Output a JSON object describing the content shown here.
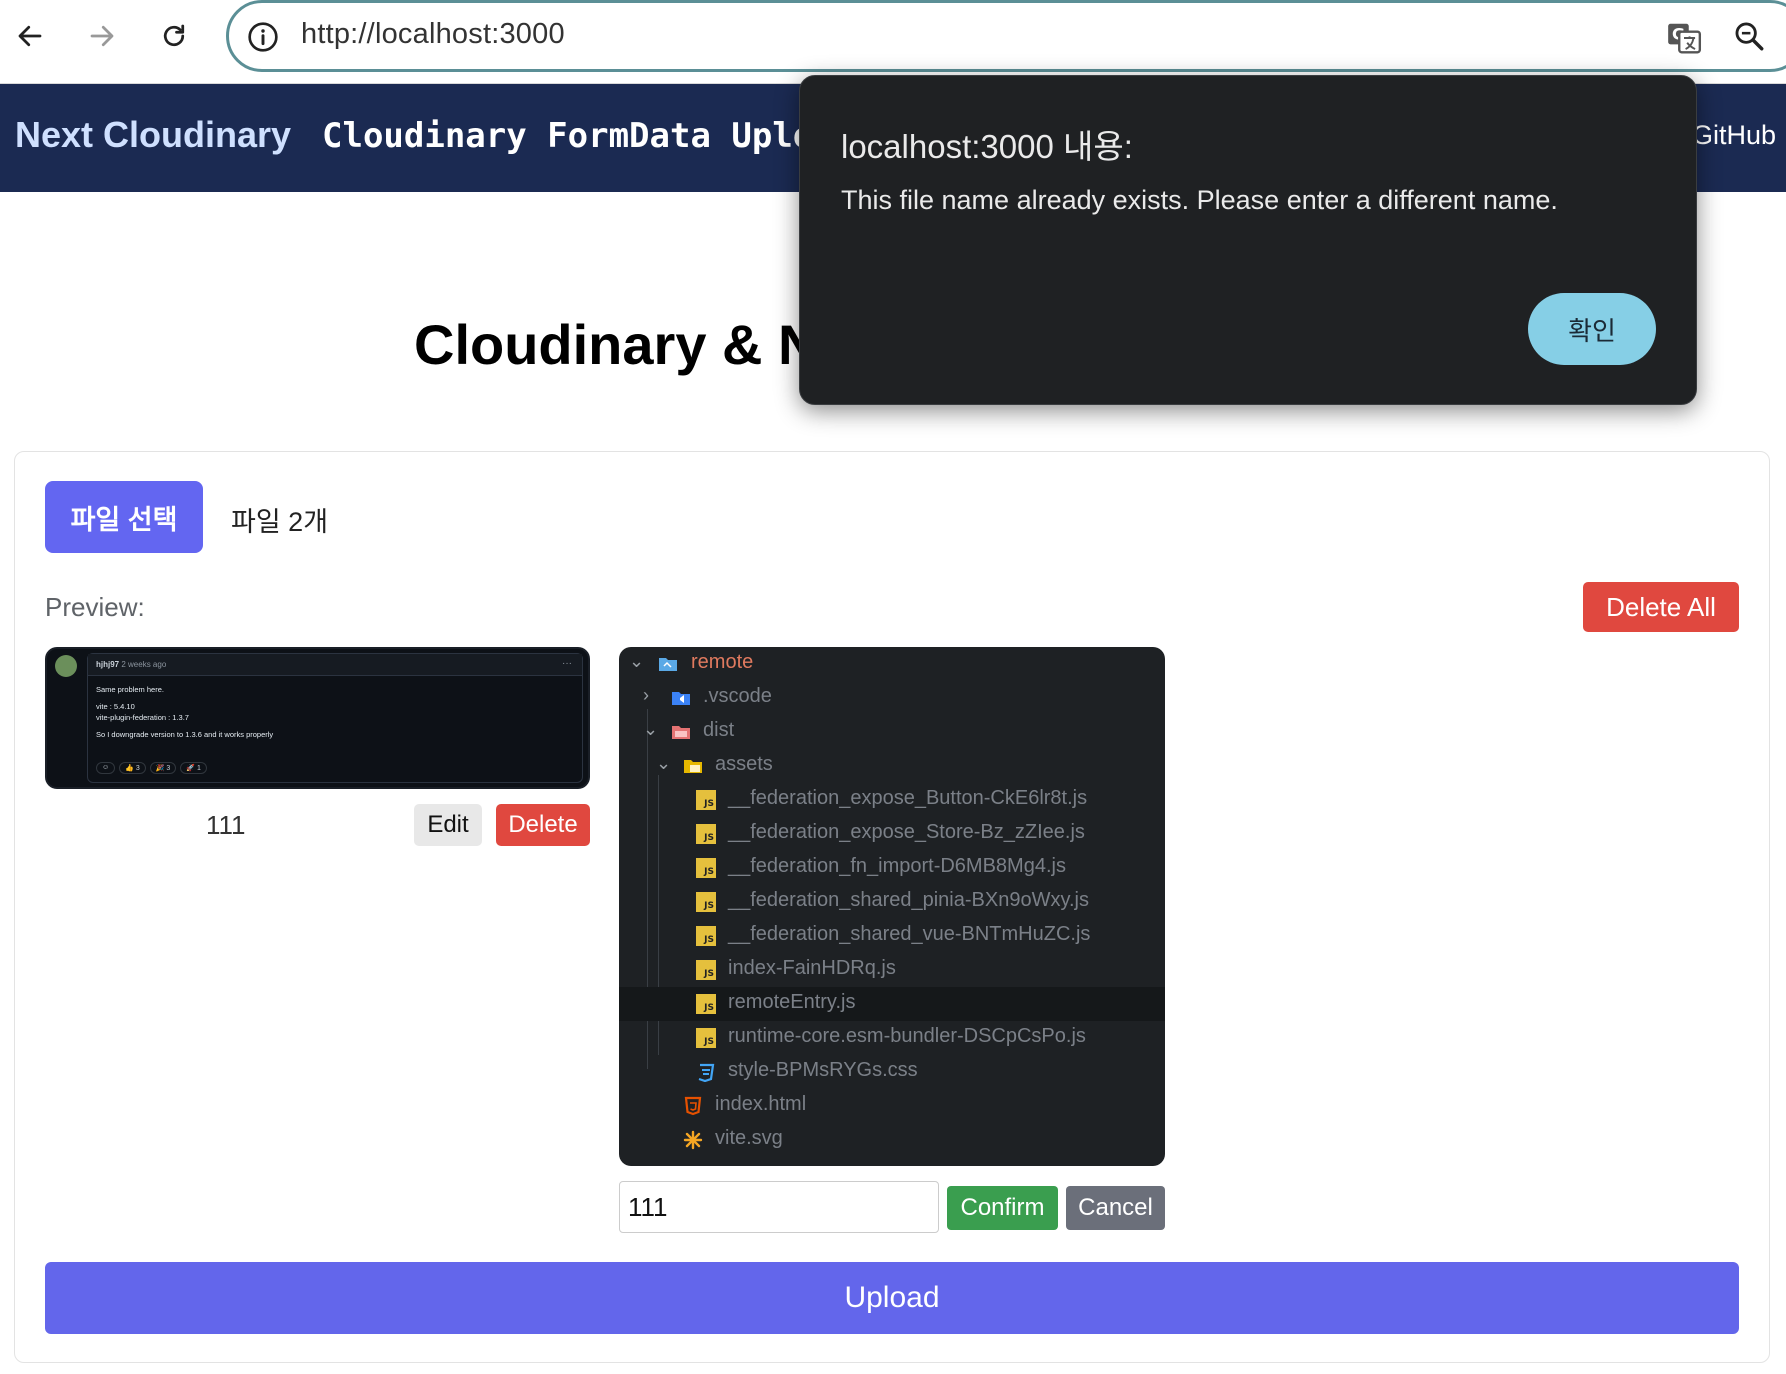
{
  "browser": {
    "url": "http://localhost:3000"
  },
  "nav": {
    "brand": "Next Cloudinary",
    "links": "Cloudinary FormData Uploa",
    "github": "GitHub"
  },
  "page": {
    "title": "Cloudinary & N"
  },
  "uploader": {
    "choose_button": "파일 선택",
    "file_count": "파일 2개",
    "preview_label": "Preview:",
    "delete_all": "Delete All",
    "upload": "Upload"
  },
  "previews": [
    {
      "name": "111",
      "edit_label": "Edit",
      "delete_label": "Delete",
      "image": {
        "username": "hjhj97",
        "time": "2 weeks ago",
        "lines": [
          "Same problem here.",
          "",
          "vite : 5.4.10",
          "vite-plugin-federation : 1.3.7",
          "",
          "So I downgrade version to 1.3.6 and it works properly"
        ],
        "reactions": [
          "☺",
          "👍 3",
          "🎉 3",
          "🚀 1"
        ]
      }
    },
    {
      "edit_value": "111",
      "confirm_label": "Confirm",
      "cancel_label": "Cancel",
      "image": {
        "tree": [
          "remote",
          ".vscode",
          "dist",
          "assets",
          "__federation_expose_Button-CkE6lr8t.js",
          "__federation_expose_Store-Bz_zZIee.js",
          "__federation_fn_import-D6MB8Mg4.js",
          "__federation_shared_pinia-BXn9oWxy.js",
          "__federation_shared_vue-BNTmHuZC.js",
          "index-FainHDRq.js",
          "remoteEntry.js",
          "runtime-core.esm-bundler-DSCpCsPo.js",
          "style-BPMsRYGs.css",
          "index.html",
          "vite.svg"
        ]
      }
    }
  ],
  "dialog": {
    "title": "localhost:3000 내용:",
    "message": "This file name already exists. Please enter a different name.",
    "ok": "확인"
  },
  "colors": {
    "nav_bg": "#1b2a52",
    "primary": "#6366f1",
    "danger": "#e0483f",
    "success": "#3a9e4f",
    "dialog_bg": "#1f2123",
    "dialog_button": "#86cfe6"
  }
}
